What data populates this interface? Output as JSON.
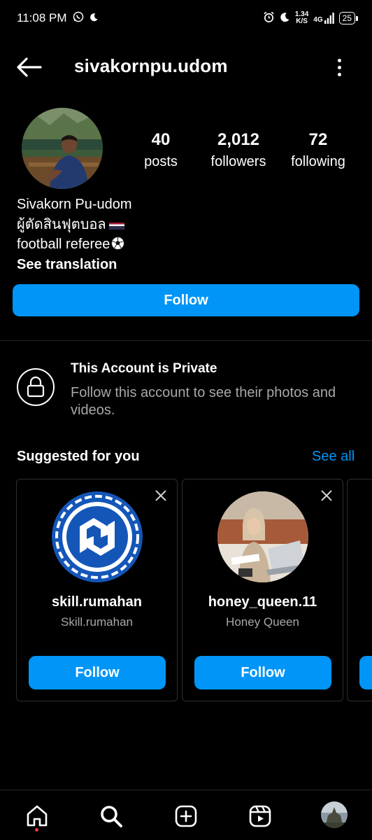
{
  "status_bar": {
    "time": "11:08 PM",
    "net_speed_value": "1.34",
    "net_speed_unit": "K/S",
    "network": "4G",
    "battery": "25"
  },
  "header": {
    "username": "sivakornpu.udom"
  },
  "profile": {
    "posts_count": "40",
    "posts_label": "posts",
    "followers_count": "2,012",
    "followers_label": "followers",
    "following_count": "72",
    "following_label": "following",
    "display_name": "Sivakorn Pu-udom",
    "bio_line1": "ผู้ตัดสินฟุตบอล",
    "bio_line2": "football referee",
    "see_translation": "See translation",
    "follow_label": "Follow"
  },
  "private_notice": {
    "title": "This Account is Private",
    "description": "Follow this account to see their photos and videos."
  },
  "suggested": {
    "title": "Suggested for you",
    "see_all": "See all",
    "cards": [
      {
        "username": "skill.rumahan",
        "name": "Skill.rumahan",
        "follow_label": "Follow"
      },
      {
        "username": "honey_queen.11",
        "name": "Honey Queen",
        "follow_label": "Follow"
      }
    ]
  },
  "colors": {
    "accent": "#0095f6",
    "background": "#000000",
    "secondary_text": "#a8a8a8",
    "notification_dot": "#ff3040"
  },
  "nav": {
    "icons": [
      "home-icon",
      "search-icon",
      "create-icon",
      "reels-icon",
      "profile-avatar"
    ]
  }
}
